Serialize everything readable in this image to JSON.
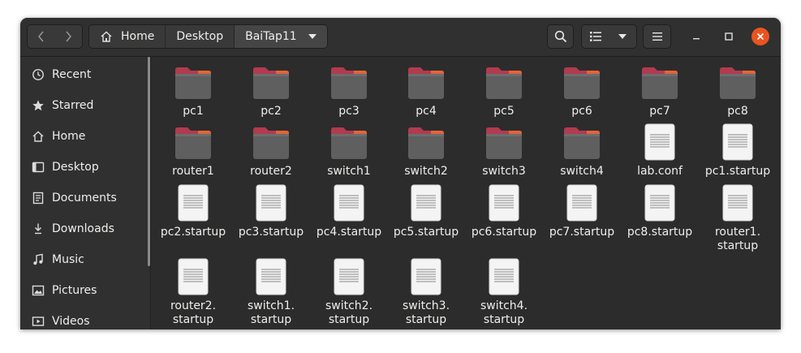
{
  "breadcrumbs": [
    "Home",
    "Desktop",
    "BaiTap11"
  ],
  "sidebar": {
    "items": [
      {
        "label": "Recent",
        "icon": "clock-icon"
      },
      {
        "label": "Starred",
        "icon": "star-icon"
      },
      {
        "label": "Home",
        "icon": "home-icon"
      },
      {
        "label": "Desktop",
        "icon": "desktop-icon"
      },
      {
        "label": "Documents",
        "icon": "document-icon"
      },
      {
        "label": "Downloads",
        "icon": "download-icon"
      },
      {
        "label": "Music",
        "icon": "music-icon"
      },
      {
        "label": "Pictures",
        "icon": "picture-icon"
      },
      {
        "label": "Videos",
        "icon": "video-icon"
      }
    ]
  },
  "files": [
    {
      "name": "pc1",
      "type": "folder"
    },
    {
      "name": "pc2",
      "type": "folder"
    },
    {
      "name": "pc3",
      "type": "folder"
    },
    {
      "name": "pc4",
      "type": "folder"
    },
    {
      "name": "pc5",
      "type": "folder"
    },
    {
      "name": "pc6",
      "type": "folder"
    },
    {
      "name": "pc7",
      "type": "folder"
    },
    {
      "name": "pc8",
      "type": "folder"
    },
    {
      "name": "router1",
      "type": "folder"
    },
    {
      "name": "router2",
      "type": "folder"
    },
    {
      "name": "switch1",
      "type": "folder"
    },
    {
      "name": "switch2",
      "type": "folder"
    },
    {
      "name": "switch3",
      "type": "folder"
    },
    {
      "name": "switch4",
      "type": "folder"
    },
    {
      "name": "lab.conf",
      "type": "text"
    },
    {
      "name": "pc1.startup",
      "type": "text"
    },
    {
      "name": "pc2.startup",
      "type": "text"
    },
    {
      "name": "pc3.startup",
      "type": "text"
    },
    {
      "name": "pc4.startup",
      "type": "text"
    },
    {
      "name": "pc5.startup",
      "type": "text"
    },
    {
      "name": "pc6.startup",
      "type": "text"
    },
    {
      "name": "pc7.startup",
      "type": "text"
    },
    {
      "name": "pc8.startup",
      "type": "text"
    },
    {
      "name": "router1.\nstartup",
      "type": "text"
    },
    {
      "name": "router2.\nstartup",
      "type": "text"
    },
    {
      "name": "switch1.\nstartup",
      "type": "text"
    },
    {
      "name": "switch2.\nstartup",
      "type": "text"
    },
    {
      "name": "switch3.\nstartup",
      "type": "text"
    },
    {
      "name": "switch4.\nstartup",
      "type": "text"
    }
  ],
  "colors": {
    "accent": "#e95420",
    "folder_body": "#5f5f5f",
    "folder_tab": "#b13b4f",
    "background": "#2c2c2c"
  }
}
